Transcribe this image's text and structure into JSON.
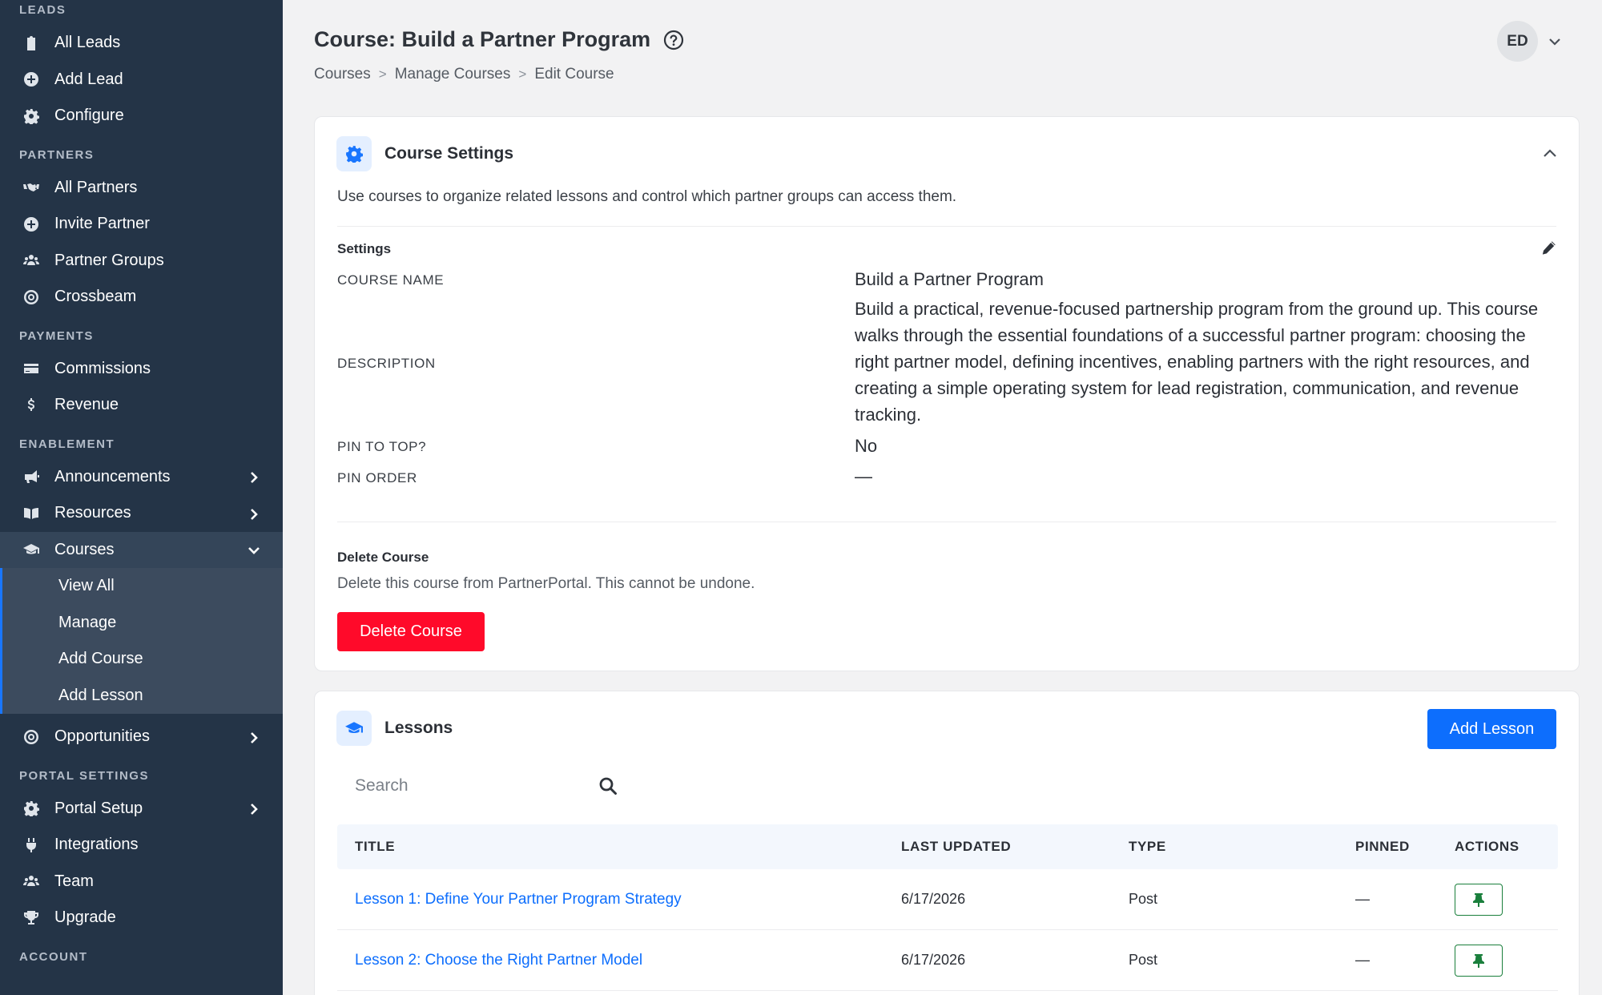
{
  "sidebar": {
    "sections": {
      "leads": "LEADS",
      "partners": "PARTNERS",
      "payments": "PAYMENTS",
      "enablement": "ENABLEMENT",
      "portal_settings": "PORTAL SETTINGS",
      "account": "ACCOUNT"
    },
    "items": {
      "all_leads": "All Leads",
      "add_lead": "Add Lead",
      "configure": "Configure",
      "all_partners": "All Partners",
      "invite_partner": "Invite Partner",
      "partner_groups": "Partner Groups",
      "crossbeam": "Crossbeam",
      "commissions": "Commissions",
      "revenue": "Revenue",
      "announcements": "Announcements",
      "resources": "Resources",
      "courses": "Courses",
      "view_all": "View All",
      "manage": "Manage",
      "add_course": "Add Course",
      "add_lesson": "Add Lesson",
      "opportunities": "Opportunities",
      "portal_setup": "Portal Setup",
      "integrations": "Integrations",
      "team": "Team",
      "upgrade": "Upgrade"
    }
  },
  "header": {
    "title": "Course: Build a Partner Program",
    "breadcrumb": [
      "Courses",
      "Manage Courses",
      "Edit Course"
    ],
    "breadcrumb_sep": ">",
    "avatar_initials": "ED"
  },
  "settings_card": {
    "title": "Course Settings",
    "description": "Use courses to organize related lessons and control which partner groups can access them.",
    "settings_label": "Settings",
    "fields": {
      "course_name_key": "COURSE NAME",
      "course_name_val": "Build a Partner Program",
      "description_key": "DESCRIPTION",
      "description_val": "Build a practical, revenue-focused partnership program from the ground up. This course walks through the essential foundations of a successful partner program: choosing the right partner model, defining incentives, enabling partners with the right resources, and creating a simple operating system for lead registration, communication, and revenue tracking.",
      "pin_key": "PIN TO TOP?",
      "pin_val": "No",
      "pin_order_key": "PIN ORDER",
      "pin_order_val": "—"
    },
    "delete_title": "Delete Course",
    "delete_desc": "Delete this course from PartnerPortal. This cannot be undone.",
    "delete_button": "Delete Course"
  },
  "lessons_card": {
    "title": "Lessons",
    "add_button": "Add Lesson",
    "search_placeholder": "Search",
    "columns": [
      "TITLE",
      "LAST UPDATED",
      "TYPE",
      "PINNED",
      "ACTIONS"
    ],
    "rows": [
      {
        "title": "Lesson 1: Define Your Partner Program Strategy",
        "updated": "6/17/2026",
        "type": "Post",
        "pinned": "—"
      },
      {
        "title": "Lesson 2: Choose the Right Partner Model",
        "updated": "6/17/2026",
        "type": "Post",
        "pinned": "—"
      }
    ]
  },
  "colors": {
    "sidebar_bg": "#243447",
    "accent_blue": "#0d6efd",
    "danger_red": "#ff0a2a",
    "pin_green": "#1a7f3c"
  }
}
